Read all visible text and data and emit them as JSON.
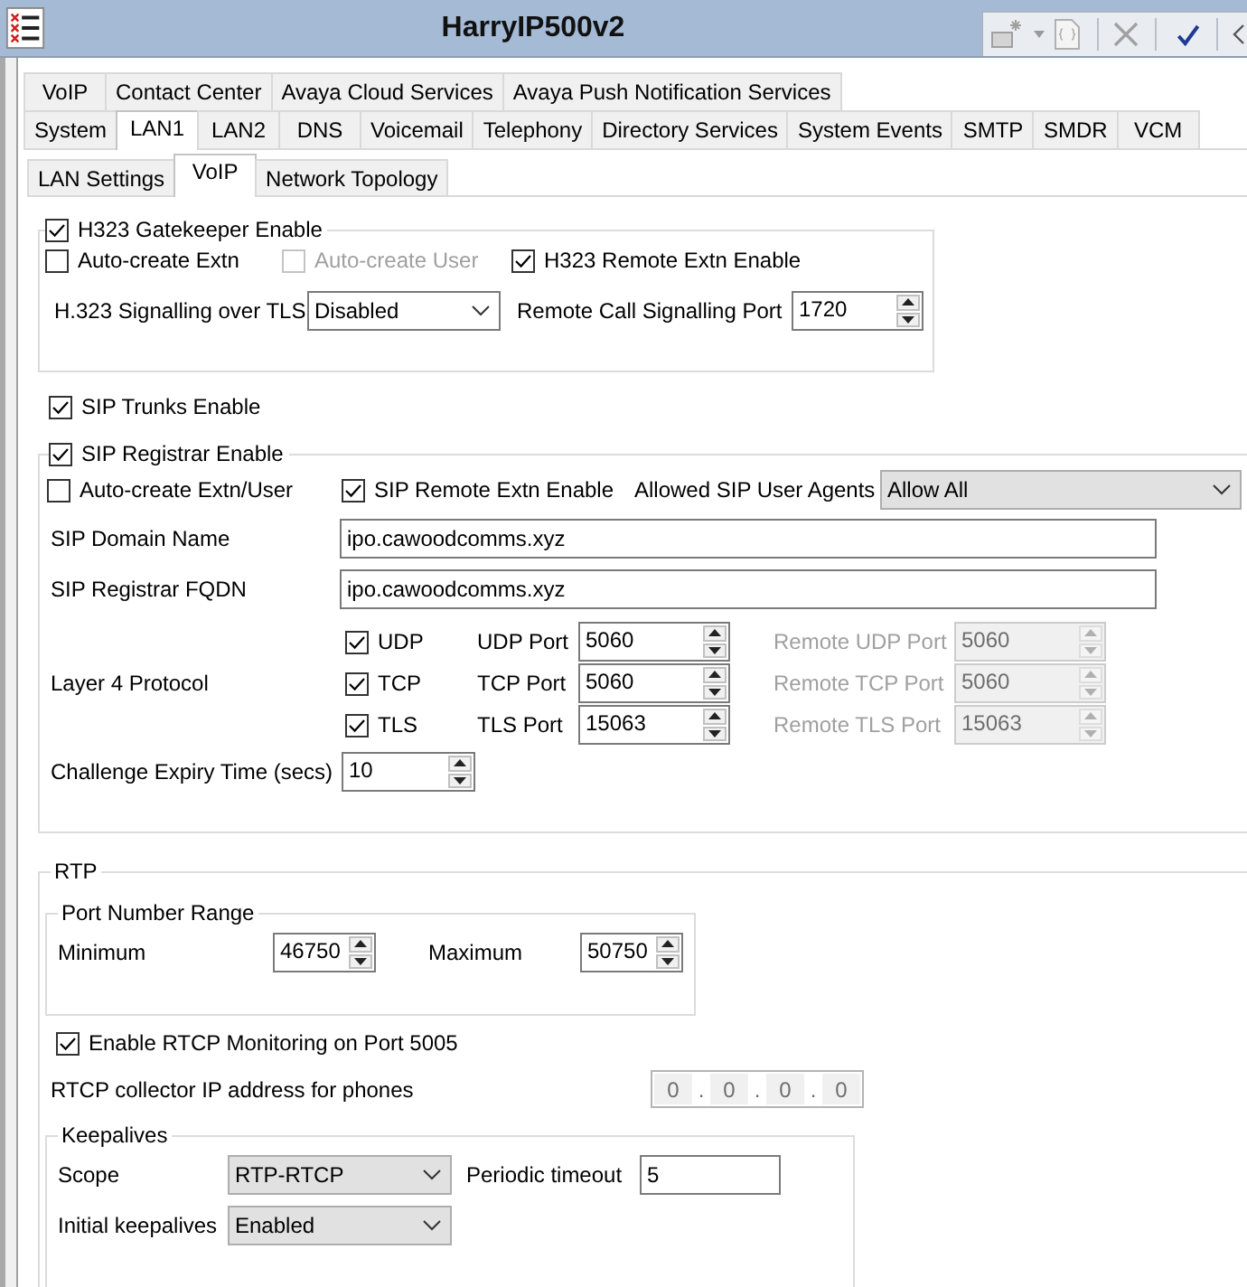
{
  "window": {
    "title": "HarryIP500v2"
  },
  "toolbar": [
    {
      "kind": "new",
      "disabled": true
    },
    {
      "kind": "dropdown",
      "disabled": true
    },
    {
      "kind": "save",
      "disabled": true
    },
    {
      "kind": "cancel",
      "disabled": true
    },
    {
      "kind": "ok",
      "disabled": false
    },
    {
      "kind": "back",
      "disabled": false
    }
  ],
  "tab_rows": [
    {
      "tabs": [
        {
          "label": "VoIP",
          "selected": false
        },
        {
          "label": "Contact Center",
          "selected": false
        },
        {
          "label": "Avaya Cloud Services",
          "selected": false
        },
        {
          "label": "Avaya Push Notification Services",
          "selected": false
        }
      ]
    },
    {
      "tabs": [
        {
          "label": "System",
          "selected": false
        },
        {
          "label": "LAN1",
          "selected": true
        },
        {
          "label": "LAN2",
          "selected": false
        },
        {
          "label": "DNS",
          "selected": false
        },
        {
          "label": "Voicemail",
          "selected": false
        },
        {
          "label": "Telephony",
          "selected": false
        },
        {
          "label": "Directory Services",
          "selected": false
        },
        {
          "label": "System Events",
          "selected": false
        },
        {
          "label": "SMTP",
          "selected": false
        },
        {
          "label": "SMDR",
          "selected": false
        },
        {
          "label": "VCM",
          "selected": false
        }
      ]
    }
  ],
  "sub_tabs": [
    {
      "label": "LAN Settings",
      "selected": false
    },
    {
      "label": "VoIP",
      "selected": true
    },
    {
      "label": "Network Topology",
      "selected": false
    }
  ],
  "h323": {
    "label": "H323 Gatekeeper Enable",
    "checked": true,
    "options": [
      {
        "label": "Auto-create Extn",
        "checked": false,
        "disabled": false
      },
      {
        "label": "Auto-create User",
        "checked": false,
        "disabled": true
      },
      {
        "label": "H323 Remote Extn Enable",
        "checked": true,
        "disabled": false
      }
    ],
    "tls": {
      "label": "H.323 Signalling over TLS",
      "value": "Disabled"
    },
    "signalling_port": {
      "label": "Remote Call Signalling Port",
      "value": "1720"
    }
  },
  "sip_trunks": {
    "label": "SIP Trunks Enable",
    "checked": true
  },
  "sip_registrar": {
    "label": "SIP Registrar Enable",
    "checked": true,
    "options": [
      {
        "label": "Auto-create Extn/User",
        "checked": false
      },
      {
        "label": "SIP Remote Extn Enable",
        "checked": true
      }
    ],
    "user_agents": {
      "label": "Allowed SIP User Agents",
      "value": "Allow All"
    },
    "fields": [
      {
        "label": "SIP Domain Name",
        "value": "ipo.cawoodcomms.xyz"
      },
      {
        "label": "SIP Registrar FQDN",
        "value": "ipo.cawoodcomms.xyz"
      }
    ],
    "layer4": {
      "label": "Layer 4 Protocol",
      "protocols": [
        {
          "label": "UDP",
          "checked": true,
          "port": {
            "label": "UDP Port",
            "value": "5060"
          },
          "remote": {
            "label": "Remote UDP Port",
            "value": "5060",
            "disabled": true
          }
        },
        {
          "label": "TCP",
          "checked": true,
          "port": {
            "label": "TCP Port",
            "value": "5060"
          },
          "remote": {
            "label": "Remote TCP Port",
            "value": "5060",
            "disabled": true
          }
        },
        {
          "label": "TLS",
          "checked": true,
          "port": {
            "label": "TLS Port",
            "value": "15063"
          },
          "remote": {
            "label": "Remote TLS Port",
            "value": "15063",
            "disabled": true
          }
        }
      ]
    },
    "challenge_expiry": {
      "label": "Challenge Expiry Time (secs)",
      "value": "10"
    }
  },
  "rtp": {
    "title": "RTP",
    "port_range": {
      "title": "Port Number Range",
      "minimum": {
        "label": "Minimum",
        "value": "46750"
      },
      "maximum": {
        "label": "Maximum",
        "value": "50750"
      }
    },
    "rtcp_monitoring": {
      "label": "Enable RTCP Monitoring on Port 5005",
      "checked": true
    },
    "collector": {
      "label": "RTCP collector IP address for phones",
      "disabled": true,
      "octets": [
        "0",
        "0",
        "0",
        "0"
      ],
      "separators": [
        ".",
        ".",
        "."
      ]
    },
    "keepalives": {
      "title": "Keepalives",
      "scope": {
        "label": "Scope",
        "value": "RTP-RTCP"
      },
      "periodic_timeout": {
        "label": "Periodic timeout",
        "value": "5"
      },
      "initial": {
        "label": "Initial keepalives",
        "value": "Enabled"
      }
    }
  }
}
